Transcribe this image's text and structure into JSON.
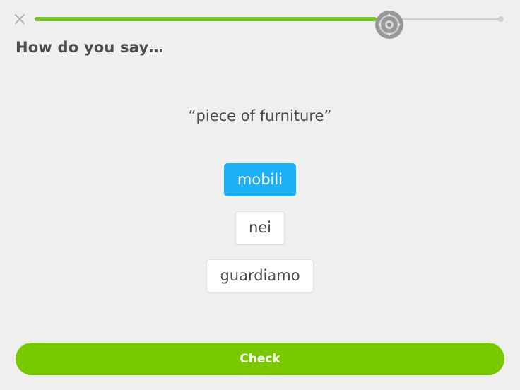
{
  "header": {
    "close_icon": "close-icon",
    "progress": {
      "fraction": 0.73,
      "fill_color": "#78c22e",
      "track_color": "#d0d0d0"
    },
    "assistive_touch_icon": "assistive-touch-icon"
  },
  "prompt": {
    "title": "How do you say…",
    "phrase": "“piece of furniture”"
  },
  "options": [
    {
      "label": "mobili",
      "selected": true
    },
    {
      "label": "nei",
      "selected": false
    },
    {
      "label": "guardiamo",
      "selected": false
    }
  ],
  "footer": {
    "check_label": "Check",
    "check_color": "#78c800"
  },
  "colors": {
    "selected": "#1cb0f6",
    "background": "#efefef"
  }
}
